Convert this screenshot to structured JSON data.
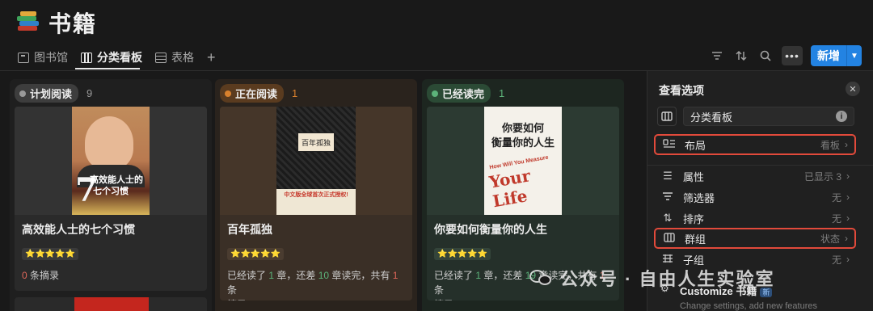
{
  "page": {
    "title": "书籍"
  },
  "tabs": [
    {
      "label": "图书馆"
    },
    {
      "label": "分类看板"
    },
    {
      "label": "表格"
    }
  ],
  "toolbar": {
    "new_label": "新增"
  },
  "board": {
    "columns": [
      {
        "status": "计划阅读",
        "count": "9",
        "pill_color": "#3d3d3d",
        "dot_color": "#9a9a9a",
        "count_color": "#9a9a9a",
        "card": {
          "title": "高效能人士的七个习惯",
          "cover_t1": "高效能人士的",
          "cover_t2": "七个习惯",
          "cover_num": "7",
          "rating": "⭐⭐⭐⭐⭐",
          "excerpt_count": "0",
          "excerpt_suffix": " 条摘录"
        }
      },
      {
        "status": "正在阅读",
        "count": "1",
        "pill_color": "#5a3b1f",
        "dot_color": "#d9812d",
        "count_color": "#d9812d",
        "card": {
          "title": "百年孤独",
          "cover_box": "百年孤独",
          "cover_band": "中文版全球首次正式授权!",
          "rating": "⭐⭐⭐⭐⭐",
          "progress": {
            "p1": "已经读了 ",
            "read": "1",
            "p2": " 章，还差 ",
            "remaining": "10",
            "p3": " 章读完，共有 ",
            "excerpts": "1",
            "p4": " 条",
            "p5": "摘录"
          }
        }
      },
      {
        "status": "已经读完",
        "count": "1",
        "pill_color": "#2b4a35",
        "dot_color": "#5cb37a",
        "count_color": "#5cb37a",
        "card": {
          "title": "你要如何衡量你的人生",
          "cover_t1": "你要如何",
          "cover_t2": "衡量你的人生",
          "cover_red1": "How Will You Measure",
          "cover_red2": "Your Life",
          "rating": "⭐⭐⭐⭐⭐",
          "progress": {
            "p1": "已经读了 ",
            "read": "1",
            "p2": " 章，还差 ",
            "remaining": "19",
            "p3": " 章读完，共有 ",
            "excerpts": "1",
            "p4": " 条",
            "p5": "摘录"
          }
        }
      }
    ]
  },
  "panel": {
    "title": "查看选项",
    "view_name": "分类看板",
    "options": [
      {
        "label": "布局",
        "value": "看板"
      },
      {
        "label": "属性",
        "value": "已显示 3"
      },
      {
        "label": "筛选器",
        "value": "无"
      },
      {
        "label": "排序",
        "value": "无"
      },
      {
        "label": "群组",
        "value": "状态"
      },
      {
        "label": "子组",
        "value": "无"
      }
    ],
    "customize": {
      "title": "Customize 书籍",
      "tag": "新",
      "subtitle": "Change settings, add new features"
    }
  },
  "watermark": {
    "text": "公众号 · 自由人生实验室"
  },
  "colors": {
    "accent": "#2383e2",
    "highlight": "#e24a3b"
  }
}
